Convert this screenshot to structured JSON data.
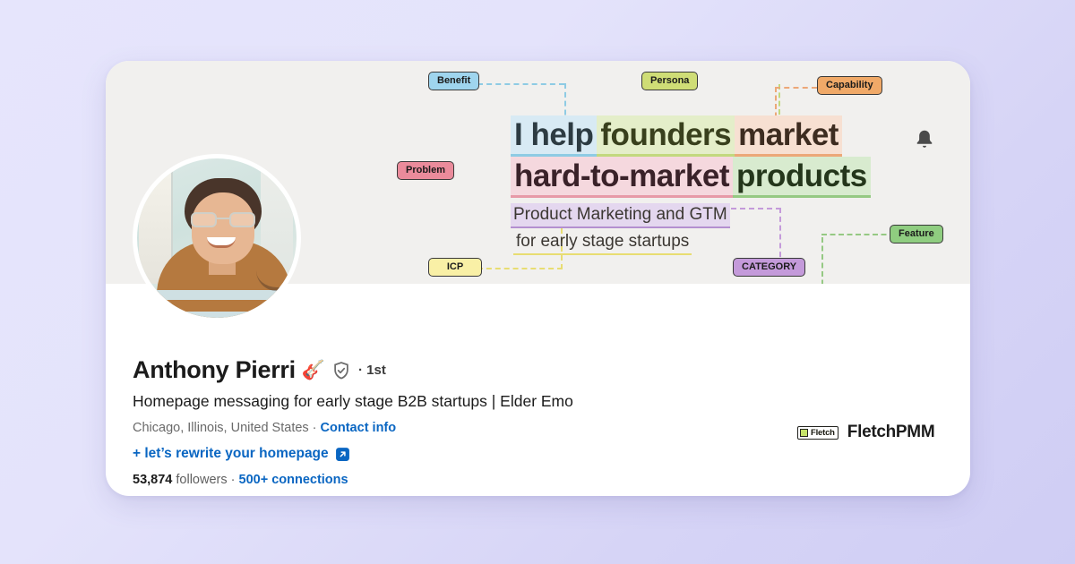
{
  "page": {
    "background_gradient_from": "#e6e5fc",
    "background_gradient_to": "#cfcdf4"
  },
  "banner": {
    "background_color": "#f1f0ee",
    "headline": {
      "line1": [
        {
          "text": "I help",
          "bg": "#d8eaf4",
          "underline": "#8ecbe4",
          "class": "seg-blue"
        },
        {
          "text": "founders",
          "bg": "#e4eec9",
          "underline": "#c2d97e",
          "class": "seg-green"
        },
        {
          "text": "market",
          "bg": "#f7e0d2",
          "underline": "#eca878",
          "class": "seg-orange"
        }
      ],
      "line2": [
        {
          "text": "hard-to-market",
          "bg": "#f5d8de",
          "underline": "#e79aa8",
          "class": "seg-pink"
        },
        {
          "text": "products",
          "bg": "#d8ebcf",
          "underline": "#95c983",
          "class": "seg-lgreen"
        }
      ],
      "sub1": "Product Marketing and GTM",
      "sub2": "for early stage startups"
    },
    "labels": [
      {
        "text": "Benefit",
        "color": "#9fd5ee"
      },
      {
        "text": "Persona",
        "color": "#cfdd76"
      },
      {
        "text": "Capability",
        "color": "#f0a968"
      },
      {
        "text": "Problem",
        "color": "#ea8b9b"
      },
      {
        "text": "Feature",
        "color": "#8fcd80"
      },
      {
        "text": "ICP",
        "color": "#f9f0a6"
      },
      {
        "text": "CATEGORY",
        "color": "#c49ada"
      }
    ]
  },
  "profile": {
    "name": "Anthony Pierri",
    "guitar_emoji": "🎸",
    "degree": "· 1st",
    "headline": "Homepage messaging for early stage B2B startups | Elder Emo",
    "location": "Chicago, Illinois, United States",
    "location_separator": " · ",
    "contact_info_label": "Contact info",
    "rewrite_link": "+ let’s rewrite your homepage",
    "followers_count": "53,874",
    "followers_label": "followers",
    "stats_separator": " · ",
    "connections": "500+ connections"
  },
  "company": {
    "logo_word": "Fletch",
    "logo_square_color": "#c6e36a",
    "name": "FletchPMM"
  },
  "actions": {
    "notifications_icon": "bell-icon",
    "external_link_icon": "external-link-icon",
    "verified_icon": "verified-shield-icon"
  },
  "colors": {
    "link_blue": "#0a66c2",
    "text_dark": "#1b1b1b",
    "text_muted": "#6a6a6a"
  }
}
